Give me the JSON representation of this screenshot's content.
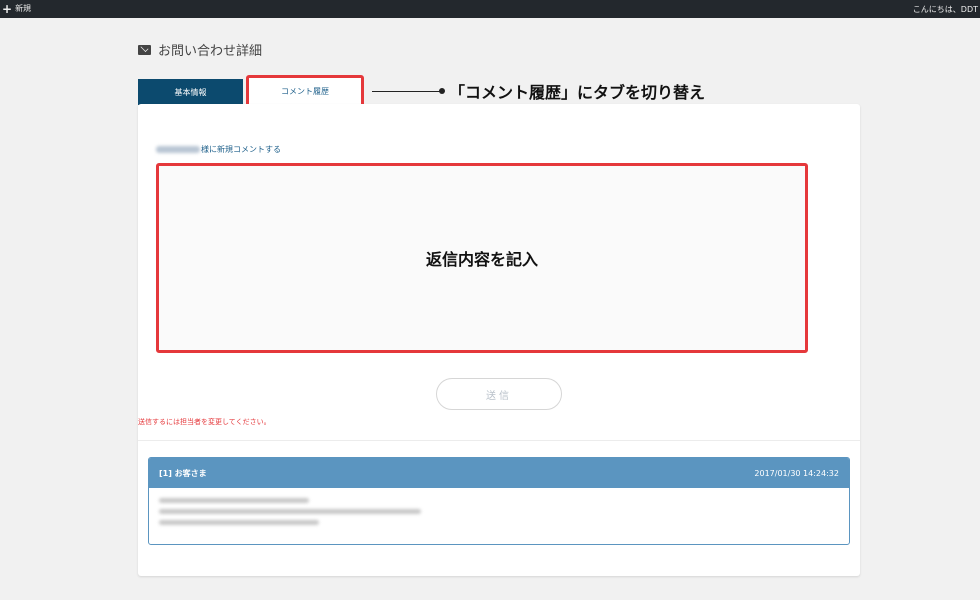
{
  "adminbar": {
    "plus_glyph": "+",
    "new_label": "新規",
    "greeting": "こんにちは、DDT"
  },
  "page": {
    "title": "お問い合わせ詳細",
    "icon": "envelope-icon"
  },
  "tabs": [
    {
      "label": "基本情報",
      "active": true
    },
    {
      "label": "コメント履歴",
      "active": false
    }
  ],
  "annotations": {
    "tab_callout": "「コメント履歴」にタブを切り替え",
    "reply_hint": "返信内容を記入"
  },
  "reply": {
    "label_suffix": "様に新規コメントする",
    "send_label": "送信",
    "warning": "送信するには担当者を変更してください。"
  },
  "comment": {
    "author": "[1] お客さま",
    "timestamp": "2017/01/30 14:24:32"
  },
  "colors": {
    "accent": "#0c4a6e",
    "highlight": "#e5383b",
    "comment_header": "#5b95c0",
    "adminbar": "#23282d"
  }
}
